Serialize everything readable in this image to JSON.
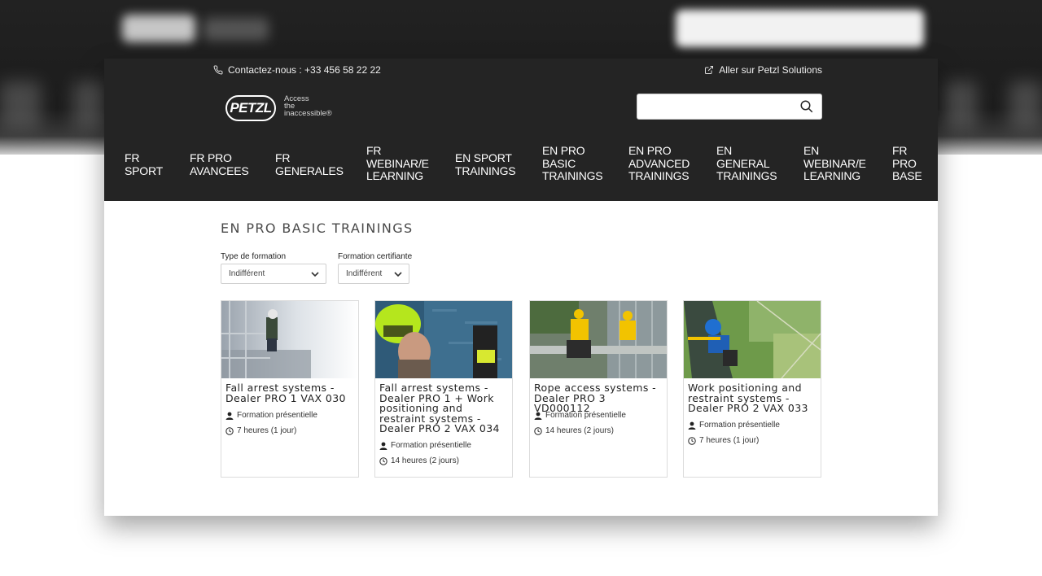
{
  "header": {
    "contact_text": "Contactez-nous : +33 456 58 22 22",
    "external_link": "Aller sur Petzl Solutions",
    "logo_text": "PETZL",
    "tagline": [
      "Access",
      "the",
      "inaccessible®"
    ],
    "search_placeholder": ""
  },
  "nav": [
    {
      "label": "FR\nSPORT"
    },
    {
      "label": "FR PRO\nAVANCEES"
    },
    {
      "label": "FR\nGENERALES"
    },
    {
      "label": "FR\nWEBINAR/E\nLEARNING"
    },
    {
      "label": "EN SPORT\nTRAININGS"
    },
    {
      "label": "EN PRO\nBASIC\nTRAININGS"
    },
    {
      "label": "EN PRO\nADVANCED\nTRAININGS"
    },
    {
      "label": "EN\nGENERAL\nTRAININGS"
    },
    {
      "label": "EN\nWEBINAR/E\nLEARNING"
    },
    {
      "label": "FR\nPRO\nBASE"
    }
  ],
  "main": {
    "title": "EN PRO BASIC TRAININGS",
    "filters": [
      {
        "label": "Type de formation",
        "value": "Indifférent"
      },
      {
        "label": "Formation certifiante",
        "value": "Indifférent"
      }
    ],
    "cards": [
      {
        "title": "Fall arrest systems - Dealer PRO 1 VAX 030",
        "type": "Formation présentielle",
        "duration": "7 heures (1 jour)"
      },
      {
        "title": "Fall arrest systems - Dealer PRO 1 + Work positioning and restraint systems - Dealer PRO 2 VAX 034",
        "type": "Formation présentielle",
        "duration": "14 heures (2 jours)"
      },
      {
        "title": "Rope access systems - Dealer PRO 3 VD000112",
        "type": "Formation présentielle",
        "duration": "14 heures (2 jours)"
      },
      {
        "title": "Work positioning and restraint systems - Dealer PRO 2 VAX 033",
        "type": "Formation présentielle",
        "duration": "7 heures (1 jour)"
      }
    ]
  },
  "colors": {
    "header_bg": "#242424",
    "text_dark": "#222222",
    "border": "#dcdcdc"
  }
}
